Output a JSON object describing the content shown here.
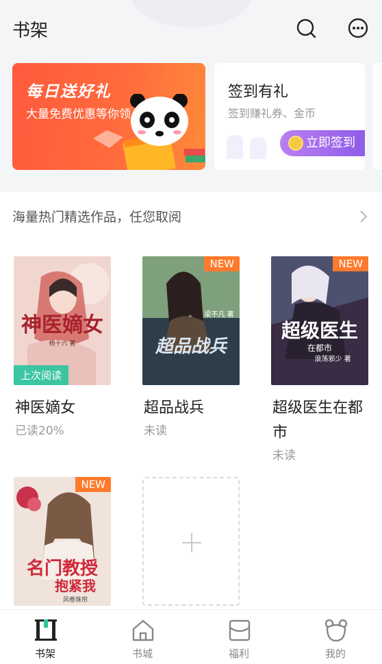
{
  "header": {
    "title": "书架",
    "search_icon": "search-icon",
    "more_icon": "more-icon"
  },
  "banners": {
    "gift": {
      "title": "每日送好礼",
      "subtitle": "大量免费优惠等你领"
    },
    "sign": {
      "title": "签到有礼",
      "subtitle": "签到赚礼券、金币",
      "button": "立即签到"
    }
  },
  "promo": {
    "text": "海量热门精选作品，任您取阅"
  },
  "books": [
    {
      "title": "神医嫡女",
      "status": "已读20%",
      "badge": "上次阅读",
      "cover_title": "神医嫡女",
      "cover_author": "杨十六 著",
      "cover_color": "#e6b9b5"
    },
    {
      "title": "超品战兵",
      "status": "未读",
      "badge": "NEW",
      "cover_title": "超品战兵",
      "cover_author": "梁不凡 著",
      "cover_color": "#2d3d4a"
    },
    {
      "title": "超级医生在都市",
      "status": "未读",
      "badge": "NEW",
      "cover_title": "超级医生",
      "cover_subtitle": "在都市",
      "cover_author": "浪荡邪少 著",
      "cover_color": "#3a2c44"
    },
    {
      "title": "",
      "status": "",
      "badge": "NEW",
      "cover_title": "名门教授",
      "cover_subtitle": "抱紧我",
      "cover_author": "风卷珠帘",
      "cover_color": "#e9d3c8"
    }
  ],
  "tabs": [
    {
      "label": "书架",
      "icon": "bookshelf-icon",
      "active": true
    },
    {
      "label": "书城",
      "icon": "bookstore-icon",
      "active": false
    },
    {
      "label": "福利",
      "icon": "welfare-icon",
      "active": false
    },
    {
      "label": "我的",
      "icon": "profile-icon",
      "active": false
    }
  ],
  "colors": {
    "accent_new": "#ff7a2c",
    "accent_last_read": "#3bc5a2",
    "sign_button": "#9b66ea",
    "gift_banner": "#ff5a3d",
    "active_tab": "#2bc49c"
  }
}
